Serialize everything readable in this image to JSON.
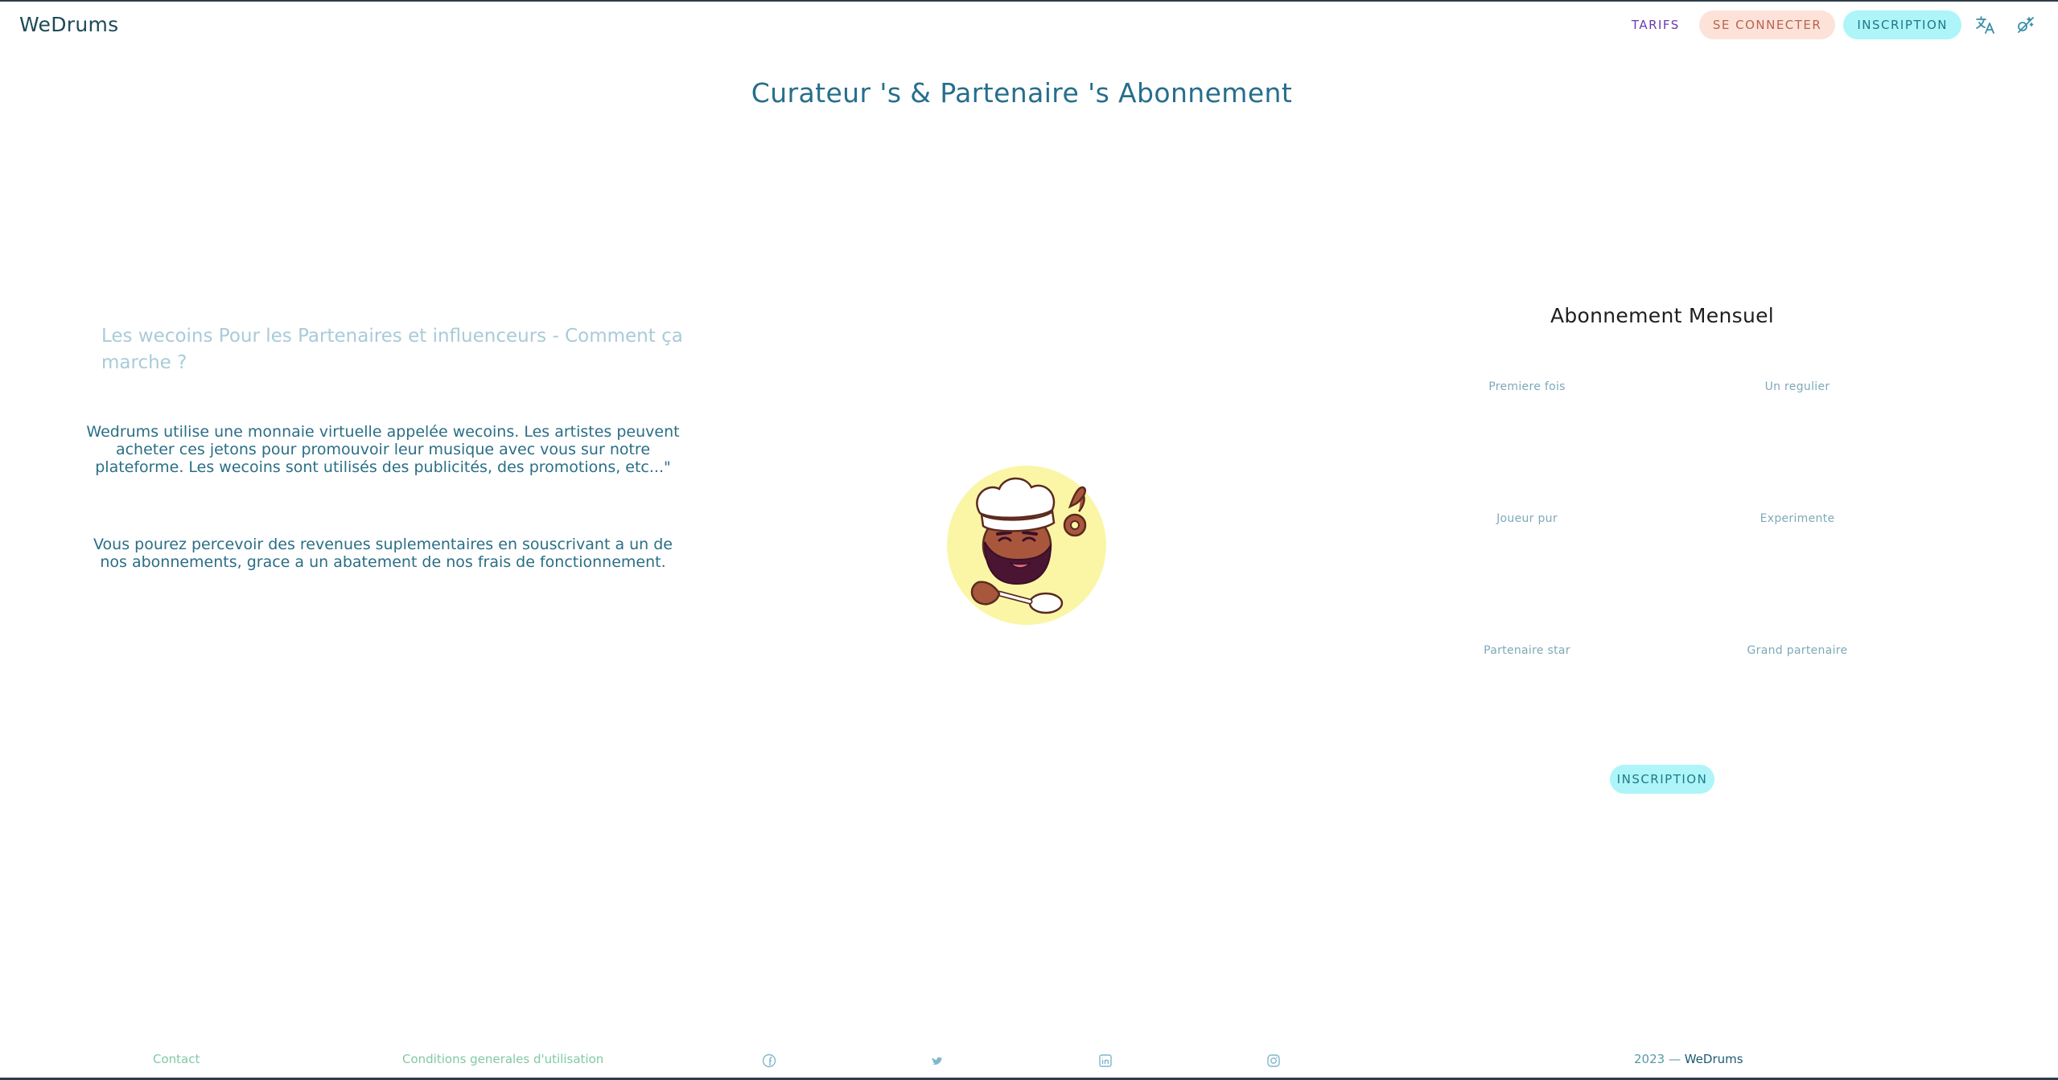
{
  "header": {
    "brand": "WeDrums",
    "nav": {
      "pricing": "TARIFS",
      "login": "SE CONNECTER",
      "signup": "INSCRIPTION"
    },
    "icons": {
      "translate": "translate-icon",
      "theme": "theme-toggle-icon"
    }
  },
  "main": {
    "title": "Curateur 's & Partenaire 's Abonnement",
    "info": {
      "heading": "Les wecoins Pour les Partenaires et influenceurs - Comment ça marche ?",
      "paragraph1": "Wedrums utilise une monnaie virtuelle appelée wecoins. Les artistes peuvent acheter ces jetons pour promouvoir leur musique avec vous sur notre plateforme. Les wecoins sont utilisés des publicités, des promotions, etc...\"",
      "paragraph2": "Vous pourez percevoir des revenues suplementaires en souscrivant a un de nos abonnements, grace a un abatement de nos frais de fonctionnement."
    },
    "illustration": "chef-character"
  },
  "subscription": {
    "title": "Abonnement Mensuel",
    "plans": [
      {
        "name": "Premiere fois"
      },
      {
        "name": "Un regulier"
      },
      {
        "name": "Joueur pur"
      },
      {
        "name": "Experimente"
      },
      {
        "name": "Partenaire star"
      },
      {
        "name": "Grand partenaire"
      }
    ],
    "button": "INSCRIPTION"
  },
  "footer": {
    "contact": "Contact",
    "terms": "Conditions generales d'utilisation",
    "social_icons": [
      "facebook-icon",
      "twitter-icon",
      "linkedin-icon",
      "instagram-icon"
    ],
    "copyright_prefix": "2023 —",
    "copyright_brand": "WeDrums"
  },
  "colors": {
    "brand": "#1d4a57",
    "title": "#266e8c",
    "accent_cyan": "#adf5f8",
    "accent_peach": "#fde2da",
    "nav_purple": "#6a3ab2",
    "footer_green": "#82c9a6"
  }
}
